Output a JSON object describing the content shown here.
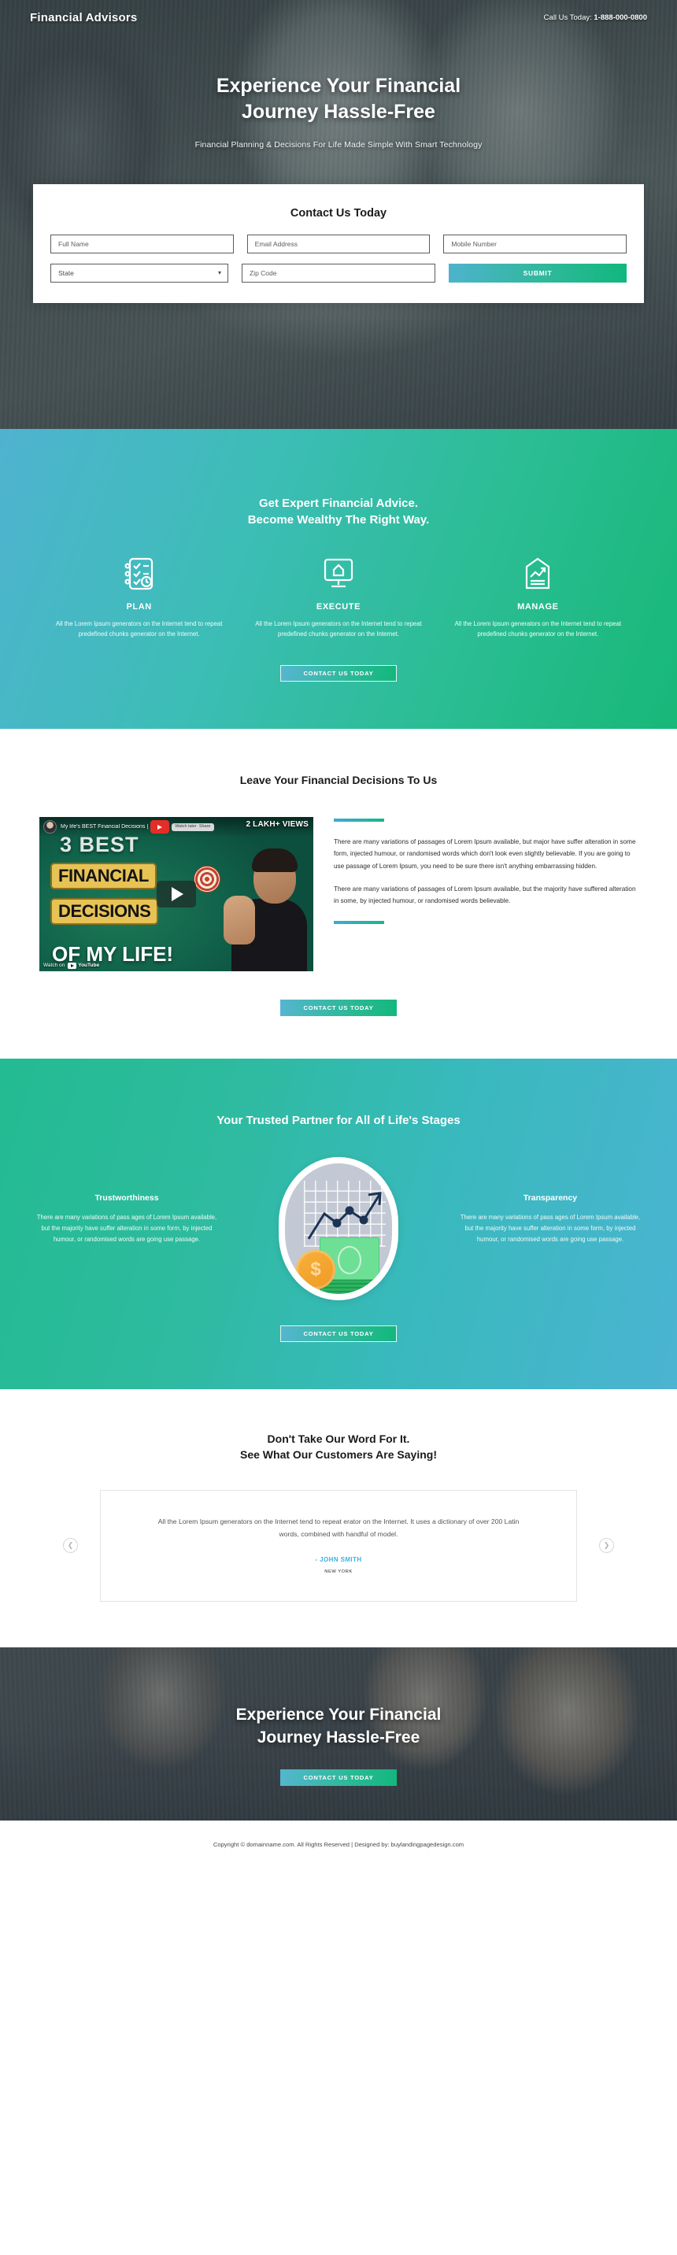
{
  "header": {
    "brand": "Financial Advisors",
    "call_prefix": "Call Us Today:",
    "phone": "1-888-000-0800"
  },
  "hero": {
    "headline_line1": "Experience Your Financial",
    "headline_line2": "Journey Hassle-Free",
    "subheadline": "Financial Planning & Decisions For Life Made Simple With Smart Technology"
  },
  "form": {
    "title": "Contact Us Today",
    "full_name_placeholder": "Full Name",
    "email_placeholder": "Email Address",
    "mobile_placeholder": "Mobile Number",
    "state_selected": "State",
    "state_options": [
      "State"
    ],
    "zip_placeholder": "Zip Code",
    "submit_label": "SUBMIT"
  },
  "features": {
    "heading_line1": "Get Expert Financial Advice.",
    "heading_line2": "Become Wealthy The Right Way.",
    "items": [
      {
        "icon": "checklist-clock-icon",
        "title": "PLAN",
        "body": "All the Lorem Ipsum generators on the Internet tend to repeat predefined chunks generator on the Internet."
      },
      {
        "icon": "desktop-monitor-home-icon",
        "title": "EXECUTE",
        "body": "All the Lorem Ipsum generators on the Internet tend to repeat predefined chunks generator on the Internet."
      },
      {
        "icon": "growth-chart-tag-icon",
        "title": "MANAGE",
        "body": "All the Lorem Ipsum generators on the Internet tend to repeat predefined chunks generator on the Internet."
      }
    ],
    "cta_label": "CONTACT US TODAY"
  },
  "video_section": {
    "heading": "Leave Your Financial Decisions To Us",
    "video": {
      "title": "My life's BEST Financial Decisions |",
      "views_badge": "2 LAKH+ VIEWS",
      "thumb_line1": "3 BEST",
      "thumb_line2": "FINANCIAL",
      "thumb_line3": "DECISIONS",
      "thumb_line4": "OF MY LIFE!",
      "watch_on": "Watch on",
      "platform": "YouTube",
      "watch_action": "Watch later",
      "share_action": "Share"
    },
    "paragraph1": "There are many variations of passages of Lorem Ipsum available, but major have suffer alteration in some form, injected humour, or randomised words which don't look even slightly believable. If you are going to use passage of Lorem Ipsum, you need to be sure there isn't anything embarrassing hidden.",
    "paragraph2": "There are many variations of passages of Lorem Ipsum available, but the majority have suffered alteration in some, by injected humour, or randomised words believable.",
    "cta_label": "CONTACT US TODAY"
  },
  "partner": {
    "heading": "Your Trusted Partner for All of Life's Stages",
    "left": {
      "title": "Trustworthiness",
      "body": "There are many variations of pass ages of Lorem Ipsum available, but the majority have suffer alteration in some form, by injected humour, or randomised words are going use passage."
    },
    "right": {
      "title": "Transparency",
      "body": "There are many variations of pass ages of Lorem Ipsum available, but the majority have suffer alteration in some form, by injected humour, or randomised words are going use passage."
    },
    "graphic": "finance-growth-money-illustration",
    "cta_label": "CONTACT US TODAY"
  },
  "testimonials": {
    "heading_line1": "Don't Take Our Word For It.",
    "heading_line2": "See What Our Customers Are Saying!",
    "prev_icon": "chevron-left-icon",
    "next_icon": "chevron-right-icon",
    "quote": "All the Lorem Ipsum generators on the Internet tend to repeat erator on the Internet. It uses a dictionary of over 200 Latin words, combined with handful of model.",
    "author": "- JOHN SMITH",
    "location": "NEW YORK"
  },
  "bottom_cta": {
    "headline_line1": "Experience Your Financial",
    "headline_line2": "Journey Hassle-Free",
    "cta_label": "CONTACT US TODAY"
  },
  "footer": {
    "copyright": "Copyright © domainname.com. All Rights Reserved | Designed by: buylandingpagedesign.com"
  },
  "colors": {
    "teal": "#2bbd94",
    "blue": "#4fb3d0",
    "accent_link": "#3bb3e0",
    "dark_text": "#1a1a1a"
  }
}
